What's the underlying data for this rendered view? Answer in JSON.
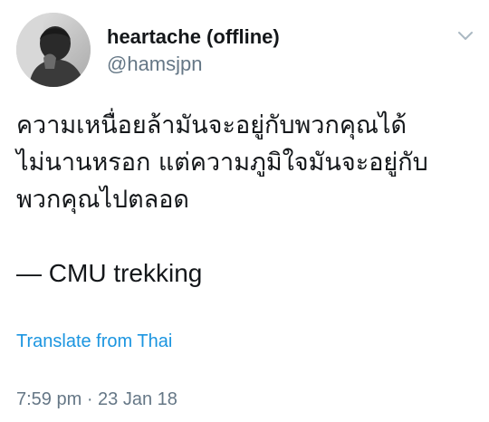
{
  "tweet": {
    "author": {
      "display_name": "heartache (offline)",
      "handle": "@hamsjpn",
      "avatar_icon": "profile-photo"
    },
    "menu_icon": "chevron-down-icon",
    "text_lines": [
      "ความเหนื่อยล้ามันจะอยู่กับพวกคุณได้",
      "ไม่นานหรอก แต่ความภูมิใจมันจะอยู่กับ",
      "พวกคุณไปตลอด"
    ],
    "signature": "— CMU trekking",
    "translate_label": "Translate from Thai",
    "timestamp": "7:59 pm · 23 Jan 18",
    "colors": {
      "link": "#1b95e0",
      "secondary_text": "#657786",
      "primary_text": "#14171a",
      "caret": "#aab8c2"
    }
  }
}
